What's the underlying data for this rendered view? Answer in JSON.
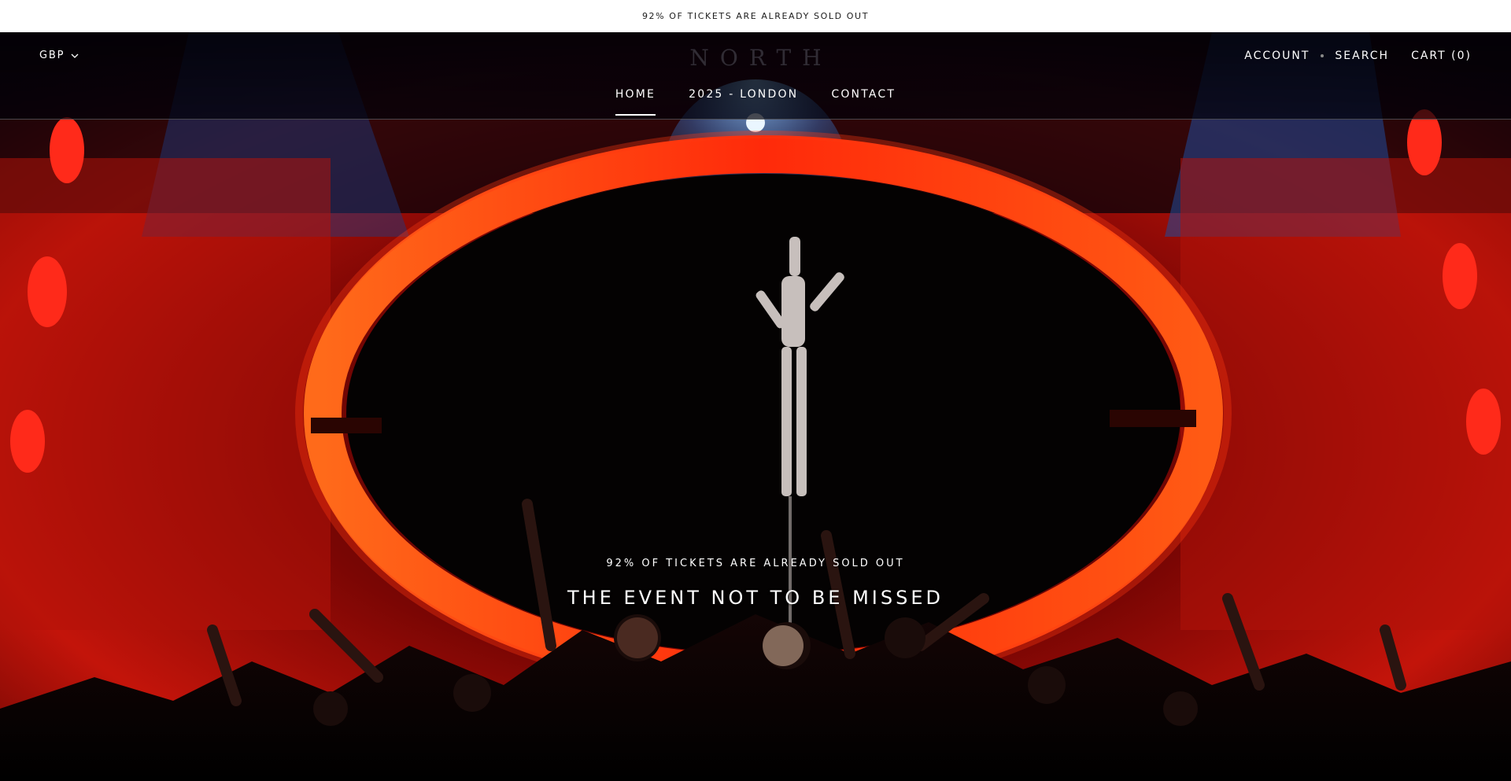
{
  "announcement": {
    "text": "92% OF TICKETS ARE ALREADY SOLD OUT"
  },
  "header": {
    "currency": "GBP",
    "logo": "NORTH",
    "account_label": "ACCOUNT",
    "search_label": "SEARCH",
    "cart_label": "CART",
    "cart_count": "(0)"
  },
  "nav": {
    "items": [
      {
        "label": "HOME",
        "active": true
      },
      {
        "label": "2025 - LONDON",
        "active": false
      },
      {
        "label": "CONTACT",
        "active": false
      }
    ]
  },
  "hero": {
    "subheading": "92% OF TICKETS ARE ALREADY SOLD OUT",
    "heading": "THE EVENT NOT TO BE MISSED"
  },
  "colors": {
    "announcement_bg": "#ffffff",
    "header_bg": "#000008",
    "accent_red": "#e0180c",
    "text_light": "#ffffff"
  }
}
